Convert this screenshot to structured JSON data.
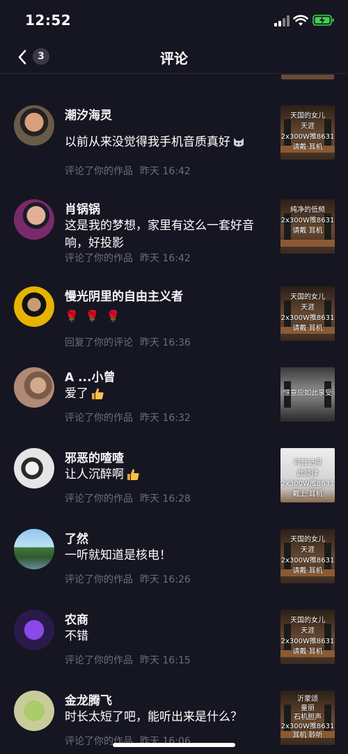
{
  "status": {
    "time": "12:52"
  },
  "header": {
    "title": "评论",
    "badge": "3"
  },
  "comments": [
    {
      "name": "潮汐海灵",
      "text": "以前从来没觉得我手机音质真好",
      "action": "评论了你的作品",
      "time": "昨天 16:42",
      "thumb": "天国的女儿\n天涯\n2x300W推8631\n请戴  耳机"
    },
    {
      "name": "肖锅锅",
      "text": "这是我的梦想，家里有这么一套好音响，好投影",
      "action": "评论了你的作品",
      "time": "昨天 16:42",
      "thumb": "纯净的低频\n2x300W推8631\n请戴  耳机"
    },
    {
      "name": "慢光阴里的自由主义者",
      "text": "🌹 🌹 🌹",
      "action": "回复了你的评论",
      "time": "昨天 16:36",
      "thumb": "天国的女儿\n天涯\n2x300W推8631\n请戴  耳机"
    },
    {
      "name": "A  ...小曾",
      "text": "爱了",
      "action": "评论了你的作品",
      "time": "昨天 16:32",
      "thumb": "惬意应如此享受"
    },
    {
      "name": "邪恶的喳喳",
      "text": "让人沉醉啊",
      "action": "评论了你的作品",
      "time": "昨天 16:28",
      "thumb": "可曾记得\n此旋律\n2x300W推8631\n戴上  耳机"
    },
    {
      "name": "了然",
      "text": "一听就知道是核电！",
      "action": "评论了你的作品",
      "time": "昨天 16:26",
      "thumb": "天国的女儿\n天涯\n2x300W推8631\n请戴  耳机"
    },
    {
      "name": "农商",
      "text": "不错",
      "action": "评论了你的作品",
      "time": "昨天 16:15",
      "thumb": "天国的女儿\n天涯\n2x300W推8631\n请戴  耳机"
    },
    {
      "name": "金龙腾飞",
      "text": "时长太短了吧，能听出来是什么？",
      "action": "评论了你的作品",
      "time": "昨天 16:06",
      "thumb": "沂蒙颂\n童丽\n石机胆声\n2x300W推8631\n耳机  聆听"
    }
  ]
}
